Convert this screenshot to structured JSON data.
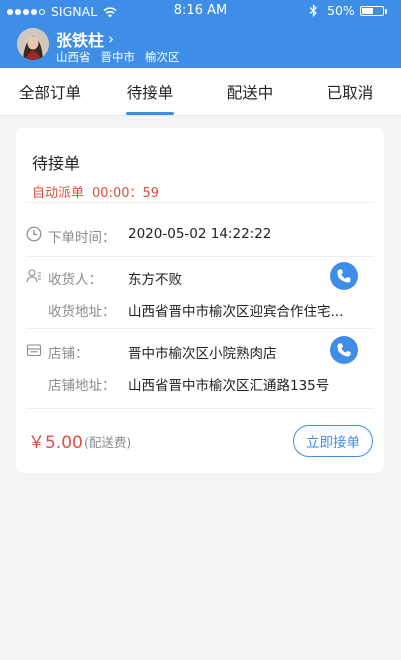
{
  "status_bar": {
    "carrier": "SIGNAL",
    "time": "8:16 AM",
    "battery": "50%",
    "battery_level": 0.5
  },
  "user": {
    "name": "张铁柱",
    "chevron": "›",
    "province": "山西省",
    "city": "晋中市",
    "district": "榆次区"
  },
  "tabs": [
    {
      "label": "全部订单"
    },
    {
      "label": "待接单",
      "active": true
    },
    {
      "label": "配送中"
    },
    {
      "label": "已取消"
    }
  ],
  "order": {
    "status_title": "待接单",
    "auto_dispatch_label": "自动派单",
    "countdown": "00:00：59",
    "order_time_label": "下单时间：",
    "order_time": "2020-05-02  14:22:22",
    "receiver_label": "收货人：",
    "receiver": "东方不败",
    "receiver_addr_label": "收货地址：",
    "receiver_addr": "山西省晋中市榆次区迎宾合作住宅...",
    "store_label": "店铺：",
    "store": "晋中市榆次区小院熟肉店",
    "store_addr_label": "店铺地址：",
    "store_addr": "山西省晋中市榆次区汇通路135号",
    "price": "￥5.00",
    "fee_note": "(配送费)",
    "accept_button": "立即接单"
  },
  "icons": {
    "clock": "clock-icon",
    "person": "person-icon",
    "store": "store-icon",
    "phone": "phone-icon"
  },
  "colors": {
    "primary": "#3e8ee8",
    "accent_red": "#d6503f",
    "background": "#f4f4f6"
  }
}
